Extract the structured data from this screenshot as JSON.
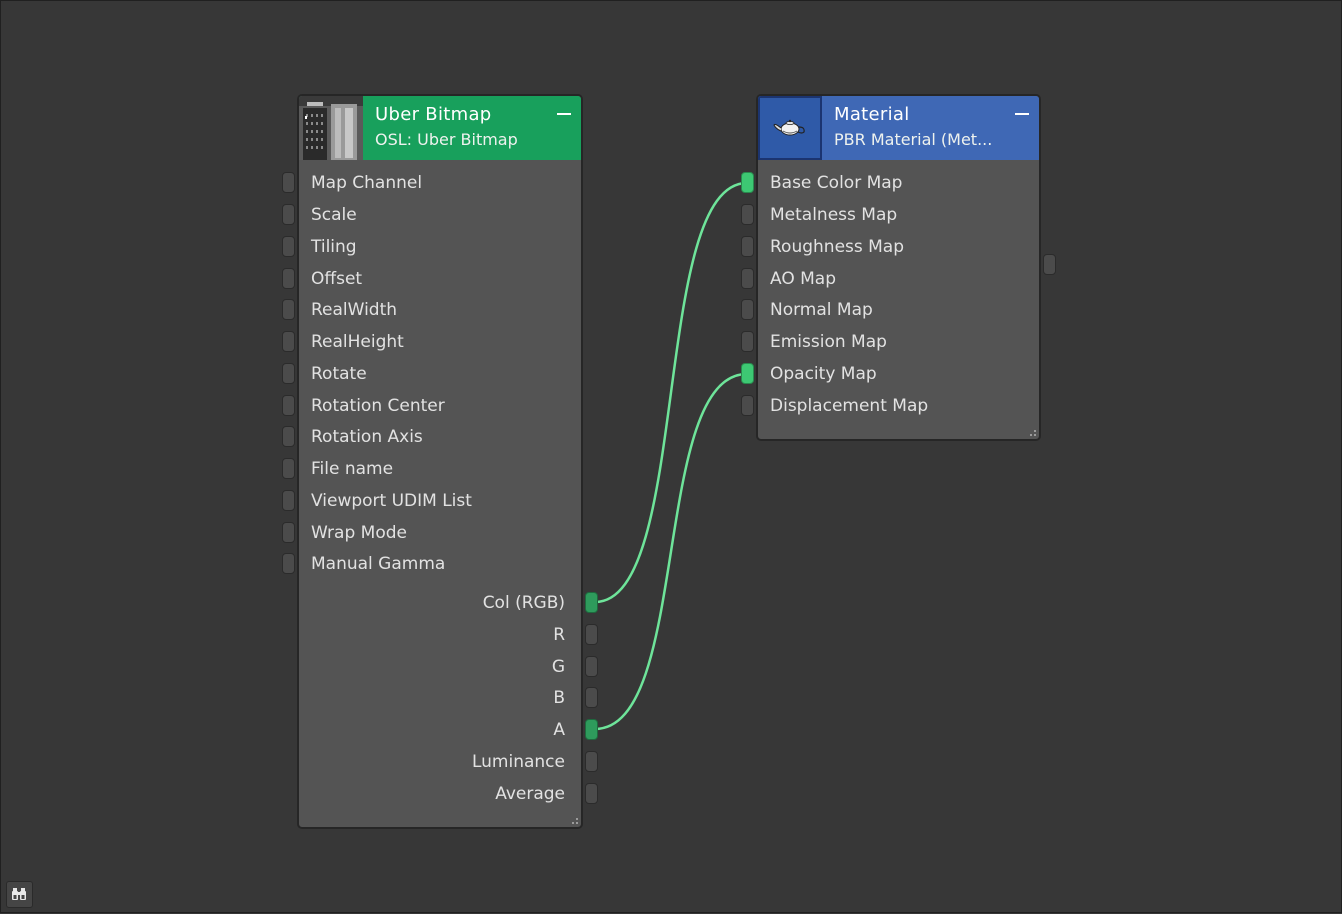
{
  "colors": {
    "background": "#373737",
    "node_body": "#545454",
    "bitmap_header": "#18a05c",
    "material_header": "#3f68b5",
    "wire": "#6ee49a",
    "socket_linked": "#3dc873",
    "socket_idle": "#4b4b4b"
  },
  "uber_bitmap": {
    "title": "Uber Bitmap",
    "subtitle": "OSL: Uber Bitmap",
    "thumbnail_icon": "building-texture-thumbnail",
    "inputs": [
      "Map Channel",
      "Scale",
      "Tiling",
      "Offset",
      "RealWidth",
      "RealHeight",
      "Rotate",
      "Rotation Center",
      "Rotation Axis",
      "File name",
      "Viewport UDIM List",
      "Wrap Mode",
      "Manual Gamma"
    ],
    "outputs": [
      "Col (RGB)",
      "R",
      "G",
      "B",
      "A",
      "Luminance",
      "Average"
    ],
    "linked_outputs": [
      "Col (RGB)",
      "A"
    ]
  },
  "material": {
    "title": "Material",
    "subtitle": "PBR Material (Met...",
    "thumbnail_icon": "teapot-icon",
    "inputs": [
      "Base Color Map",
      "Metalness Map",
      "Roughness Map",
      "AO Map",
      "Normal Map",
      "Emission Map",
      "Opacity Map",
      "Displacement Map"
    ],
    "linked_inputs": [
      "Base Color Map",
      "Opacity Map"
    ]
  },
  "connections": [
    {
      "from": "Col (RGB)",
      "to": "Base Color Map"
    },
    {
      "from": "A",
      "to": "Opacity Map"
    }
  ],
  "toolbar": {
    "search_icon": "binoculars-icon"
  }
}
